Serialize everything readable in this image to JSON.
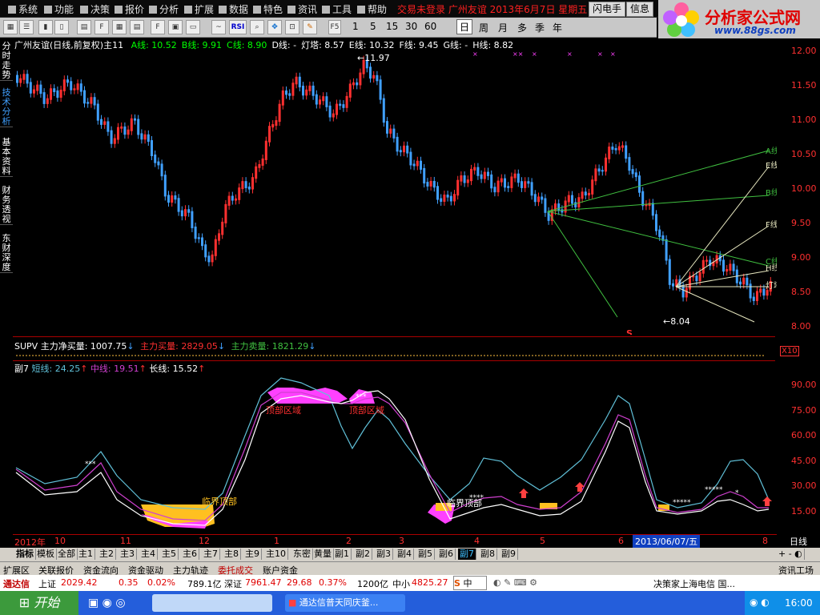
{
  "menu": {
    "items": [
      "系统",
      "功能",
      "决策",
      "报价",
      "分析",
      "扩展",
      "数据",
      "特色",
      "资讯",
      "工具",
      "帮助"
    ],
    "title": "交易未登录  广州友谊 2013年6月7日 星期五",
    "flash_trade": "闪电手",
    "info": "信息"
  },
  "toolbar": {
    "buttons": [
      "F5",
      "1",
      "5",
      "15",
      "30",
      "60"
    ],
    "periods": [
      "日",
      "周",
      "月",
      "多",
      "季",
      "年"
    ]
  },
  "logo": {
    "line1": "分析家公式网",
    "line2": "www.88gs.com"
  },
  "left_tabs": [
    "分时走势",
    "技术分析",
    "基本资料",
    "财务透视",
    "东财深度"
  ],
  "main_panel": {
    "header_title": "广州友谊(日线,前复权)主11",
    "lines": [
      {
        "label": "A线:",
        "value": "10.52",
        "color": "#00ff00"
      },
      {
        "label": "B线:",
        "value": "9.91",
        "color": "#00ff00"
      },
      {
        "label": "C线:",
        "value": "8.90",
        "color": "#00ff00"
      },
      {
        "label": "D线:",
        "value": "-",
        "color": "#ffffff"
      },
      {
        "label": "灯塔:",
        "value": "8.57",
        "color": "#ffffff"
      },
      {
        "label": "E线:",
        "value": "10.32",
        "color": "#ffffff"
      },
      {
        "label": "F线:",
        "value": "9.45",
        "color": "#ffffff"
      },
      {
        "label": "G线:",
        "value": "-",
        "color": "#ffffff"
      },
      {
        "label": "H线:",
        "value": "8.82",
        "color": "#ffffff"
      }
    ],
    "high_label": "11.97",
    "low_label": "8.04",
    "s_mark": "S",
    "line_labels": [
      "A线",
      "E线",
      "B线",
      "F线",
      "C线",
      "H线",
      "灯塔"
    ],
    "axis": [
      "12.00",
      "11.50",
      "11.00",
      "10.50",
      "10.00",
      "9.50",
      "9.00",
      "8.50",
      "8.00"
    ]
  },
  "supv_panel": {
    "title": "SUPV 主力净买量:",
    "net": "1007.75",
    "buy_label": "主力买量:",
    "buy": "2829.05",
    "sell_label": "主力卖量:",
    "sell": "1821.29",
    "scale": "X10"
  },
  "sub_panel": {
    "name": "副7",
    "short_label": "短线:",
    "short": "24.25",
    "mid_label": "中线:",
    "mid": "19.51",
    "long_label": "长线:",
    "long": "15.52",
    "axis": [
      "90.00",
      "75.00",
      "60.00",
      "45.00",
      "30.00",
      "15.00"
    ],
    "labels": [
      "顶部区域",
      "顶部区域",
      "临界顶部",
      "临界顶部"
    ]
  },
  "time_axis": {
    "labels": [
      "2012年",
      "10",
      "11",
      "12",
      "1",
      "2",
      "3",
      "4",
      "5",
      "6",
      "8"
    ],
    "cursor_date": "2013/06/07/五",
    "period": "日线"
  },
  "bottom_tabs": [
    "指标",
    "模板",
    "全部",
    "主1",
    "主2",
    "主3",
    "主4",
    "主5",
    "主6",
    "主7",
    "主8",
    "主9",
    "主10",
    "东密",
    "黄量",
    "副1",
    "副2",
    "副3",
    "副4",
    "副5",
    "副6",
    "副7",
    "副8",
    "副9"
  ],
  "bottom_links": [
    "扩展区",
    "关联报价",
    "资金流向",
    "资金驱动",
    "主力轨迹",
    "委托成交",
    "账户资金"
  ],
  "bottom_right": "资讯工场",
  "ticker": {
    "brand": "通达信",
    "sh_label": "上证",
    "sh_value": "2029.42",
    "sh_change": "0.35",
    "sh_pct": "0.02%",
    "sh_amount": "789.1亿",
    "sz_label": "深证",
    "sz_value": "7961.47",
    "sz_change": "29.68",
    "sz_pct": "0.37%",
    "sz_amount": "1200亿",
    "smb_label": "中小",
    "smb_value": "4825.27",
    "ime": "中",
    "news": "决策家上海电信 国..."
  },
  "taskbar": {
    "start": "开始",
    "task": "通达信普天同庆釜...",
    "clock": "16:00"
  },
  "colors": {
    "up": "#ff3030",
    "down": "#40a0ff",
    "short": "#60c0d8",
    "mid": "#d040d0",
    "long": "#ffffff",
    "top_zone": "#ff40ff",
    "bottom_zone": "#ffc020"
  }
}
